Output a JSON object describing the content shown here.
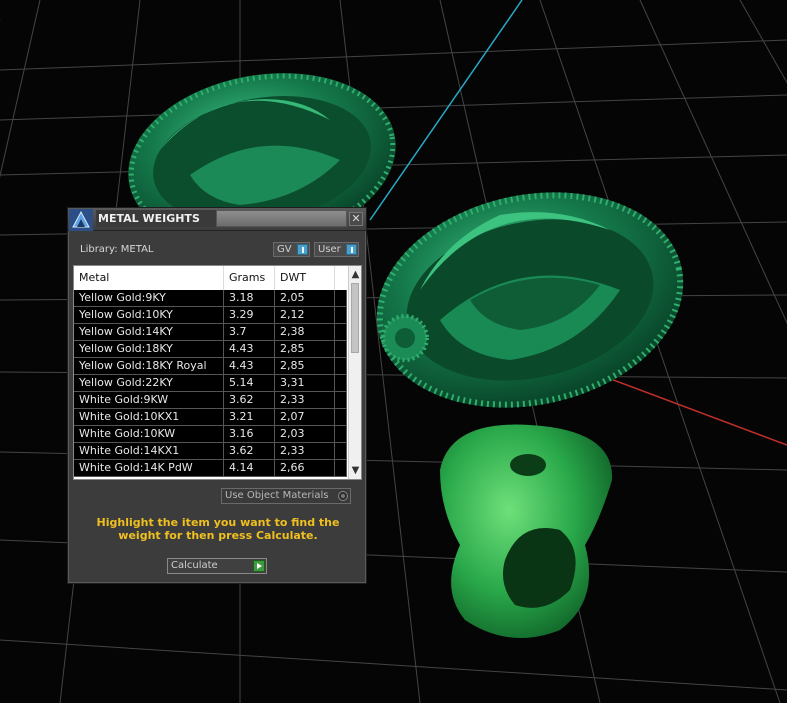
{
  "dialog": {
    "title": "METAL WEIGHTS",
    "close_label": "✕",
    "library_label": "Library: METAL",
    "toggles": {
      "gv": "GV",
      "user": "User"
    },
    "columns": {
      "metal": "Metal",
      "grams": "Grams",
      "dwt": "DWT"
    },
    "rows": [
      {
        "metal": "Yellow Gold:9KY",
        "grams": "3.18",
        "dwt": "2,05"
      },
      {
        "metal": "Yellow Gold:10KY",
        "grams": "3.29",
        "dwt": "2,12"
      },
      {
        "metal": "Yellow Gold:14KY",
        "grams": "3.7",
        "dwt": "2,38"
      },
      {
        "metal": "Yellow Gold:18KY",
        "grams": "4.43",
        "dwt": "2,85"
      },
      {
        "metal": "Yellow Gold:18KY Royal",
        "grams": "4.43",
        "dwt": "2,85"
      },
      {
        "metal": "Yellow Gold:22KY",
        "grams": "5.14",
        "dwt": "3,31"
      },
      {
        "metal": "White Gold:9KW",
        "grams": "3.62",
        "dwt": "2,33"
      },
      {
        "metal": "White Gold:10KX1",
        "grams": "3.21",
        "dwt": "2,07"
      },
      {
        "metal": "White Gold:10KW",
        "grams": "3.16",
        "dwt": "2,03"
      },
      {
        "metal": "White Gold:14KX1",
        "grams": "3.62",
        "dwt": "2,33"
      },
      {
        "metal": "White Gold:14K PdW",
        "grams": "4.14",
        "dwt": "2,66"
      }
    ],
    "use_object_materials": "Use Object Materials",
    "instructions": "Highlight the item you want to find the weight for then press Calculate.",
    "calculate_label": "Calculate"
  },
  "colors": {
    "accent_toggle": "#4aa0c8",
    "instructions_text": "#f0c020",
    "calculate_play": "#3f9b3f",
    "model_green": "#1f8a55"
  }
}
